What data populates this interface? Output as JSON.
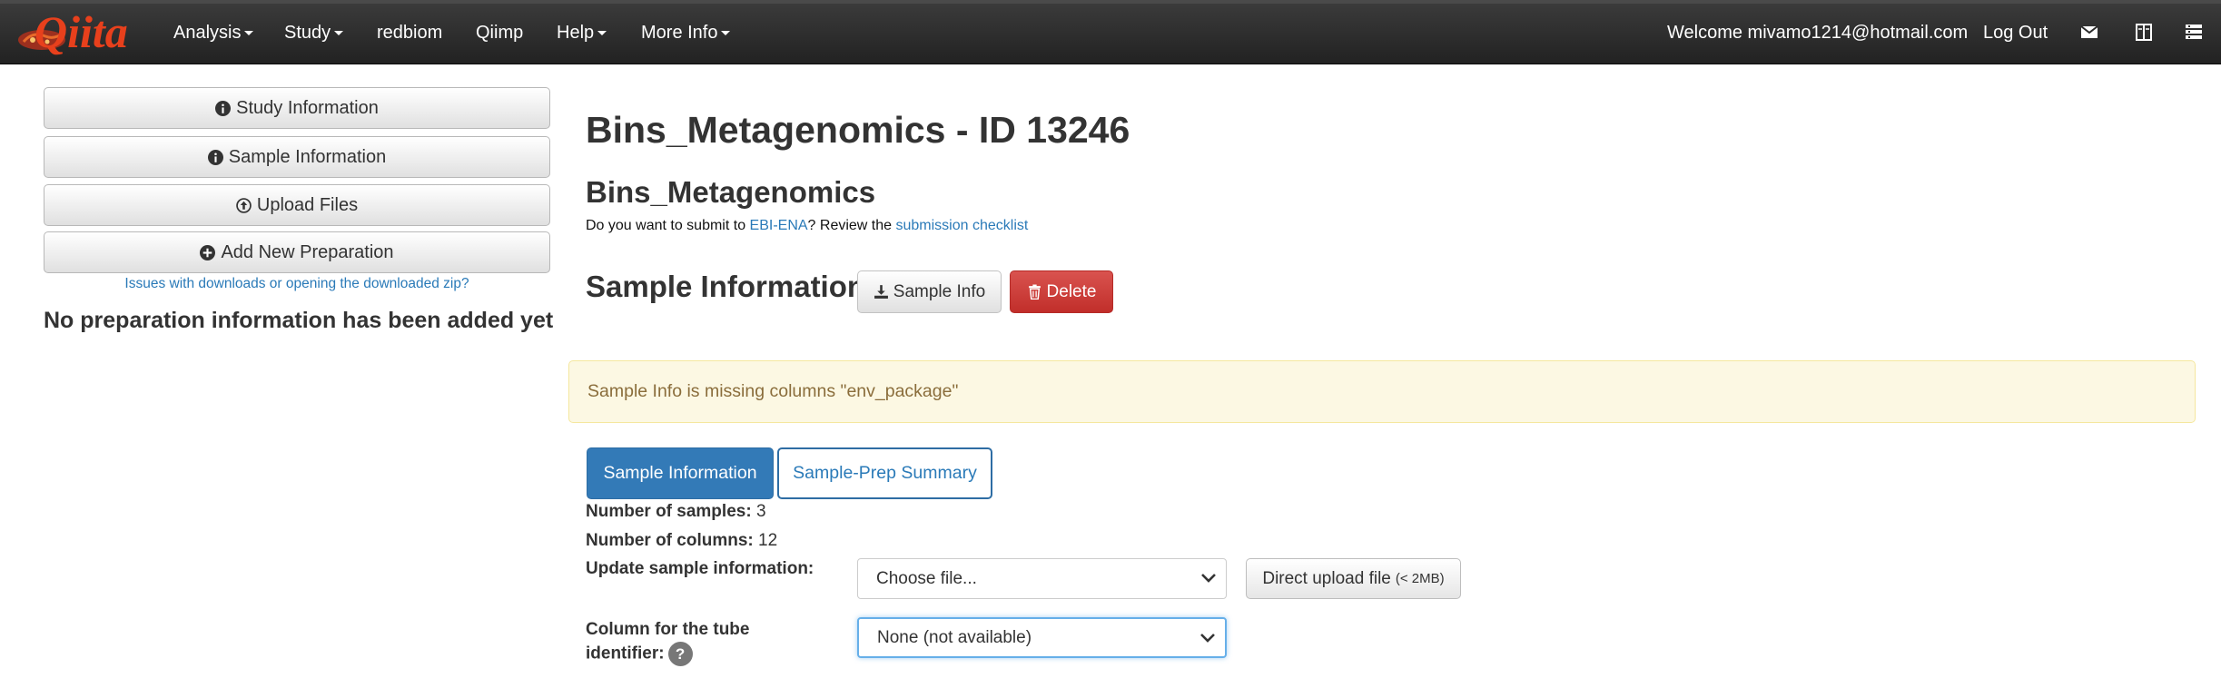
{
  "navbar": {
    "brand": "Qiita",
    "items": [
      {
        "label": "Analysis",
        "dropdown": true
      },
      {
        "label": "Study",
        "dropdown": true
      },
      {
        "label": "redbiom",
        "dropdown": false
      },
      {
        "label": "Qiimp",
        "dropdown": false
      },
      {
        "label": "Help",
        "dropdown": true
      },
      {
        "label": "More Info",
        "dropdown": true
      }
    ],
    "welcome": "Welcome mivamo1214@hotmail.com",
    "logout": "Log Out",
    "icons": [
      "envelope-icon",
      "book-icon",
      "list-icon"
    ]
  },
  "sidebar": {
    "buttons": [
      {
        "label": "Study Information",
        "icon": "info-circle-icon"
      },
      {
        "label": "Sample Information",
        "icon": "info-circle-icon"
      },
      {
        "label": "Upload Files",
        "icon": "upload-circle-icon"
      },
      {
        "label": "Add New Preparation",
        "icon": "plus-circle-icon"
      }
    ],
    "issues_link": "Issues with downloads or opening the downloaded zip?",
    "no_prep_text": "No preparation information has been added yet"
  },
  "main": {
    "page_title": "Bins_Metagenomics - ID 13246",
    "study_title": "Bins_Metagenomics",
    "submit_prefix": "Do you want to submit to ",
    "submit_link1": "EBI-ENA",
    "submit_middle": "? Review the ",
    "submit_link2": "submission checklist",
    "section_title": "Sample Information",
    "download_button": "Sample Info",
    "delete_button": "Delete",
    "alert_text": "Sample Info is missing columns \"env_package\"",
    "tabs": [
      {
        "label": "Sample Information",
        "active": true
      },
      {
        "label": "Sample-Prep Summary",
        "active": false
      }
    ],
    "num_samples_label": "Number of samples:",
    "num_samples_value": "3",
    "num_columns_label": "Number of columns:",
    "num_columns_value": "12",
    "update_label": "Update sample information:",
    "file_select": "Choose file...",
    "upload_button": "Direct upload file",
    "upload_limit": "(< 2MB)",
    "tube_label_line1": "Column for the tube",
    "tube_label_line2": "identifier:",
    "help_badge": "?",
    "tube_select": "None (not available)"
  },
  "colors": {
    "navbar": "#222222",
    "primary": "#337ab7",
    "danger": "#d9534f",
    "warning_bg": "#fcf8e3",
    "warning_text": "#8a6d3b",
    "link": "#2a7ab8"
  }
}
